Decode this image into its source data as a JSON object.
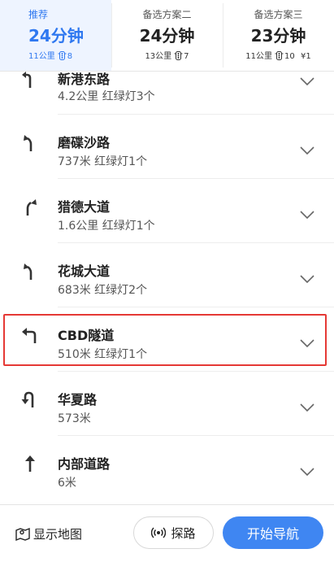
{
  "route_options": [
    {
      "label": "推荐",
      "time": "24分钟",
      "distance": "11公里",
      "lights": "8",
      "toll": ""
    },
    {
      "label": "备选方案二",
      "time": "24分钟",
      "distance": "13公里",
      "lights": "7",
      "toll": ""
    },
    {
      "label": "备选方案三",
      "time": "23分钟",
      "distance": "11公里",
      "lights": "10",
      "toll": "¥1"
    }
  ],
  "steps": [
    {
      "road": "新港东路",
      "info": "4.2公里 红绿灯3个",
      "turn": "turn-left-icon"
    },
    {
      "road": "磨碟沙路",
      "info": "737米 红绿灯1个",
      "turn": "bear-left-icon"
    },
    {
      "road": "猎德大道",
      "info": "1.6公里 红绿灯1个",
      "turn": "bear-right-icon"
    },
    {
      "road": "花城大道",
      "info": "683米 红绿灯2个",
      "turn": "bear-left-icon"
    },
    {
      "road": "CBD隧道",
      "info": "510米 红绿灯1个",
      "turn": "turn-left-icon"
    },
    {
      "road": "华夏路",
      "info": "573米",
      "turn": "u-turn-icon"
    },
    {
      "road": "内部道路",
      "info": "6米",
      "turn": "straight-icon"
    }
  ],
  "bottom": {
    "show_map": "显示地图",
    "explore": "探路",
    "start": "开始导航"
  },
  "colors": {
    "accent": "#2f78f0",
    "start_button": "#3f86f2",
    "highlight": "#e53935"
  }
}
